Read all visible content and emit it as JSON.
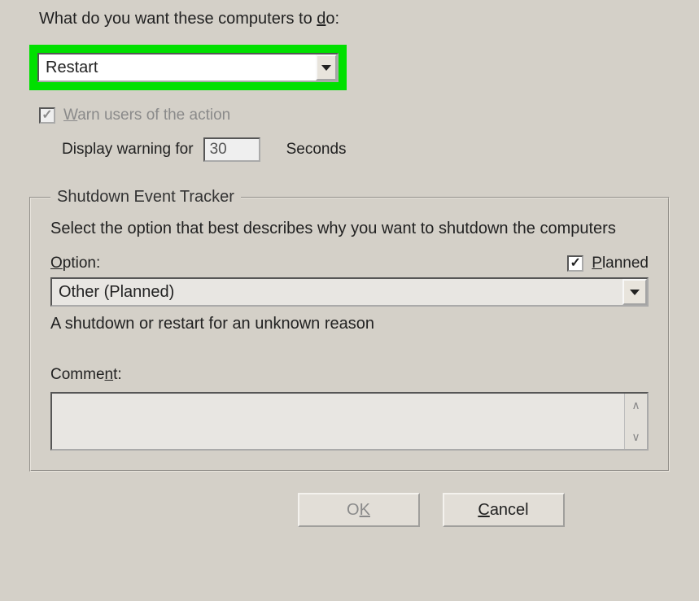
{
  "prompt": {
    "label_pre": "What do you want these computers to ",
    "label_u": "d",
    "label_post": "o:"
  },
  "action": {
    "selected": "Restart"
  },
  "warn": {
    "label_u": "W",
    "label_post": "arn users of the action",
    "display_pre": "Display warning for",
    "seconds_value": "30",
    "seconds_label": "Seconds"
  },
  "tracker": {
    "legend": "Shutdown Event Tracker",
    "description": "Select the option that best describes why you want to shutdown the computers",
    "option_label_u": "O",
    "option_label_post": "ption:",
    "planned_u": "P",
    "planned_post": "lanned",
    "option_selected": "Other (Planned)",
    "option_description": "A shutdown or restart for an unknown reason",
    "comment_label_pre": "Comme",
    "comment_label_u": "n",
    "comment_label_post": "t:",
    "comment_value": ""
  },
  "buttons": {
    "ok_pre": "O",
    "ok_u": "K",
    "cancel_u": "C",
    "cancel_post": "ancel"
  }
}
